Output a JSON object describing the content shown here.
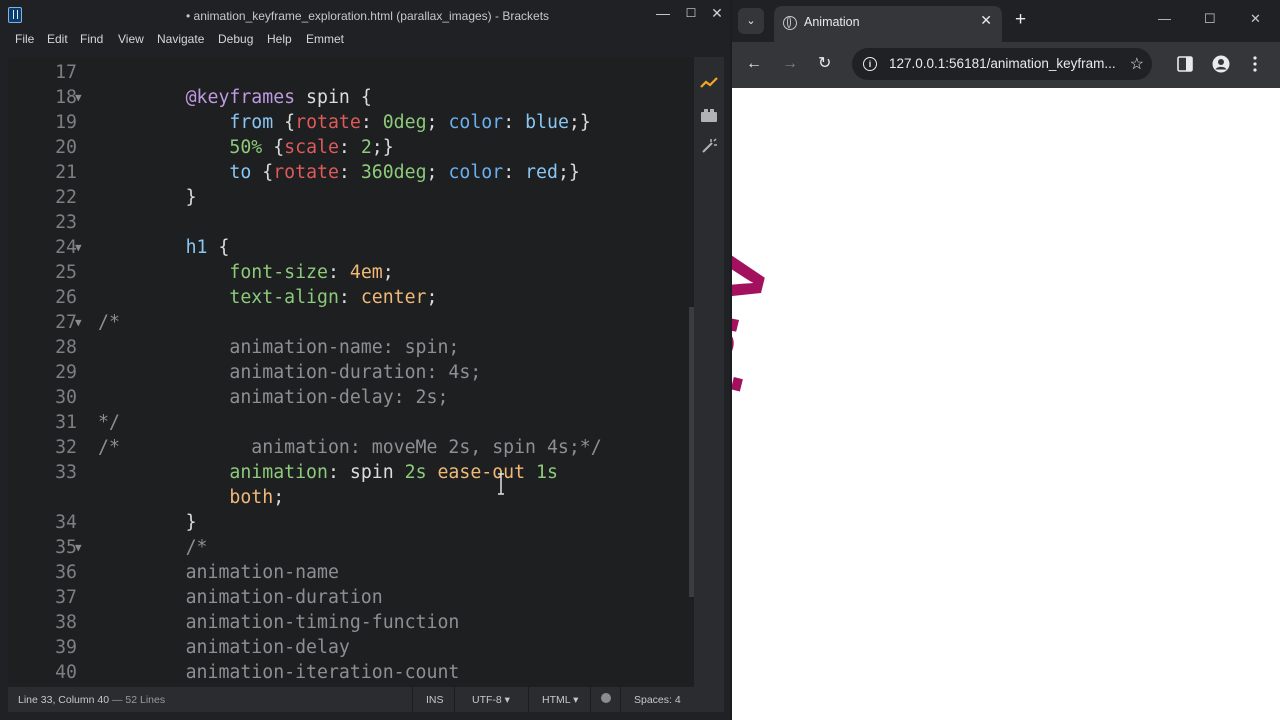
{
  "editor_window": {
    "title": "• animation_keyframe_exploration.html (parallax_images) - Brackets",
    "controls": {
      "minimize": "—",
      "maximize": "☐",
      "close": "✕"
    }
  },
  "menu": [
    "File",
    "Edit",
    "Find",
    "View",
    "Navigate",
    "Debug",
    "Help",
    "Emmet"
  ],
  "code_lines": [
    {
      "num": "17",
      "fold": "",
      "tokens": []
    },
    {
      "num": "18",
      "fold": "▼",
      "tokens": [
        {
          "t": "        ",
          "c": "plain"
        },
        {
          "t": "@keyframes",
          "c": "kw-purple"
        },
        {
          "t": " spin ",
          "c": "plain"
        },
        {
          "t": "{",
          "c": "plain"
        }
      ]
    },
    {
      "num": "19",
      "fold": "",
      "tokens": [
        {
          "t": "            ",
          "c": "plain"
        },
        {
          "t": "from",
          "c": "kw-teal"
        },
        {
          "t": " {",
          "c": "plain"
        },
        {
          "t": "rotate",
          "c": "str"
        },
        {
          "t": ": ",
          "c": "plain"
        },
        {
          "t": "0deg",
          "c": "num"
        },
        {
          "t": "; ",
          "c": "plain"
        },
        {
          "t": "color",
          "c": "prop"
        },
        {
          "t": ": ",
          "c": "plain"
        },
        {
          "t": "blue",
          "c": "kw-teal"
        },
        {
          "t": ";}",
          "c": "plain"
        }
      ]
    },
    {
      "num": "20",
      "fold": "",
      "tokens": [
        {
          "t": "            ",
          "c": "plain"
        },
        {
          "t": "50%",
          "c": "num"
        },
        {
          "t": " {",
          "c": "plain"
        },
        {
          "t": "scale",
          "c": "str"
        },
        {
          "t": ": ",
          "c": "plain"
        },
        {
          "t": "2",
          "c": "num"
        },
        {
          "t": ";}",
          "c": "plain"
        }
      ]
    },
    {
      "num": "21",
      "fold": "",
      "tokens": [
        {
          "t": "            ",
          "c": "plain"
        },
        {
          "t": "to",
          "c": "kw-teal"
        },
        {
          "t": " {",
          "c": "plain"
        },
        {
          "t": "rotate",
          "c": "str"
        },
        {
          "t": ": ",
          "c": "plain"
        },
        {
          "t": "360deg",
          "c": "num"
        },
        {
          "t": "; ",
          "c": "plain"
        },
        {
          "t": "color",
          "c": "prop"
        },
        {
          "t": ": ",
          "c": "plain"
        },
        {
          "t": "red",
          "c": "kw-teal"
        },
        {
          "t": ";}",
          "c": "plain"
        }
      ]
    },
    {
      "num": "22",
      "fold": "",
      "tokens": [
        {
          "t": "        }",
          "c": "plain"
        }
      ]
    },
    {
      "num": "23",
      "fold": "",
      "tokens": []
    },
    {
      "num": "24",
      "fold": "▼",
      "tokens": [
        {
          "t": "        ",
          "c": "plain"
        },
        {
          "t": "h1",
          "c": "sel"
        },
        {
          "t": " {",
          "c": "plain"
        }
      ]
    },
    {
      "num": "25",
      "fold": "",
      "tokens": [
        {
          "t": "            ",
          "c": "plain"
        },
        {
          "t": "font-size",
          "c": "num"
        },
        {
          "t": ": ",
          "c": "plain"
        },
        {
          "t": "4em",
          "c": "val"
        },
        {
          "t": ";",
          "c": "plain"
        }
      ]
    },
    {
      "num": "26",
      "fold": "",
      "tokens": [
        {
          "t": "            ",
          "c": "plain"
        },
        {
          "t": "text-align",
          "c": "num"
        },
        {
          "t": ": ",
          "c": "plain"
        },
        {
          "t": "center",
          "c": "val"
        },
        {
          "t": ";",
          "c": "plain"
        }
      ]
    },
    {
      "num": "27",
      "fold": "▼",
      "tokens": [
        {
          "t": "/*",
          "c": "comment"
        }
      ]
    },
    {
      "num": "28",
      "fold": "",
      "tokens": [
        {
          "t": "            animation-name: spin;",
          "c": "comment"
        }
      ]
    },
    {
      "num": "29",
      "fold": "",
      "tokens": [
        {
          "t": "            animation-duration: 4s;",
          "c": "comment"
        }
      ]
    },
    {
      "num": "30",
      "fold": "",
      "tokens": [
        {
          "t": "            animation-delay: 2s;",
          "c": "comment"
        }
      ]
    },
    {
      "num": "31",
      "fold": "",
      "tokens": [
        {
          "t": "*/",
          "c": "comment"
        }
      ]
    },
    {
      "num": "32",
      "fold": "",
      "tokens": [
        {
          "t": "/*            animation: moveMe 2s, spin 4s;*/",
          "c": "comment"
        }
      ]
    },
    {
      "num": "33",
      "fold": "",
      "tokens": [
        {
          "t": "            ",
          "c": "plain"
        },
        {
          "t": "animation",
          "c": "num"
        },
        {
          "t": ": ",
          "c": "plain"
        },
        {
          "t": "spin ",
          "c": "plain"
        },
        {
          "t": "2s",
          "c": "num"
        },
        {
          "t": " ",
          "c": "plain"
        },
        {
          "t": "ease-out",
          "c": "val"
        },
        {
          "t": " ",
          "c": "plain"
        },
        {
          "t": "1s",
          "c": "num"
        }
      ]
    },
    {
      "num": "",
      "fold": "",
      "tokens": [
        {
          "t": "            ",
          "c": "plain"
        },
        {
          "t": "both",
          "c": "val"
        },
        {
          "t": ";",
          "c": "plain"
        }
      ]
    },
    {
      "num": "34",
      "fold": "",
      "tokens": [
        {
          "t": "        }",
          "c": "plain"
        }
      ]
    },
    {
      "num": "35",
      "fold": "▼",
      "tokens": [
        {
          "t": "        /*",
          "c": "comment"
        }
      ]
    },
    {
      "num": "36",
      "fold": "",
      "tokens": [
        {
          "t": "        animation-name",
          "c": "comment"
        }
      ]
    },
    {
      "num": "37",
      "fold": "",
      "tokens": [
        {
          "t": "        animation-duration",
          "c": "comment"
        }
      ]
    },
    {
      "num": "38",
      "fold": "",
      "tokens": [
        {
          "t": "        animation-timing-function",
          "c": "comment"
        }
      ]
    },
    {
      "num": "39",
      "fold": "",
      "tokens": [
        {
          "t": "        animation-delay",
          "c": "comment"
        }
      ]
    },
    {
      "num": "40",
      "fold": "",
      "tokens": [
        {
          "t": "        animation-iteration-count",
          "c": "comment"
        }
      ]
    }
  ],
  "status_bar": {
    "position": "Line 33, Column 40",
    "lines": "— 52 Lines",
    "mode": "INS",
    "encoding": "UTF-8 ▾",
    "language": "HTML ▾",
    "spaces": "Spaces: 4"
  },
  "browser": {
    "tab_title": "Animation",
    "url": "127.0.0.1:56181/animation_keyfram...",
    "heading": "Animation",
    "heading_color": "#a3105e"
  },
  "icons": [
    "live-preview-icon",
    "extension-manager-icon",
    "quick-edit-icon",
    "globe-icon",
    "info-icon",
    "star-icon",
    "sidebar-icon",
    "profile-icon",
    "kebab-menu-icon"
  ]
}
